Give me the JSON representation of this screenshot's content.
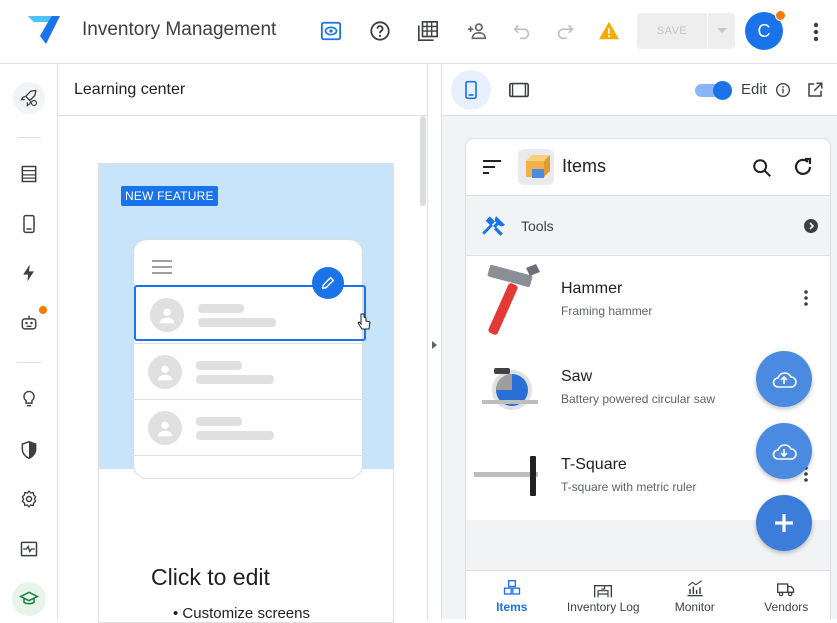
{
  "app": {
    "title": "Inventory Management",
    "avatar_initial": "C"
  },
  "toolbar": {
    "save_label": "SAVE"
  },
  "learning_center": {
    "title": "Learning center",
    "badge": "NEW FEATURE",
    "heading": "Click to edit",
    "bullets": [
      "Customize screens"
    ]
  },
  "preview_toolbar": {
    "edit_label": "Edit"
  },
  "device": {
    "title": "Items",
    "category": "Tools",
    "items": [
      {
        "name": "Hammer",
        "description": "Framing hammer"
      },
      {
        "name": "Saw",
        "description": "Battery powered circular saw"
      },
      {
        "name": "T-Square",
        "description": "T-square with metric ruler"
      }
    ],
    "nav": [
      {
        "label": "Items",
        "icon": "cubes-icon",
        "active": true
      },
      {
        "label": "Inventory Log",
        "icon": "warehouse-icon",
        "active": false
      },
      {
        "label": "Monitor",
        "icon": "chart-icon",
        "active": false
      },
      {
        "label": "Vendors",
        "icon": "truck-icon",
        "active": false
      }
    ]
  },
  "colors": {
    "accent": "#1a73e8",
    "fab": "#4a8ae0",
    "warning": "#f9ab00",
    "notify": "#f57c00"
  }
}
